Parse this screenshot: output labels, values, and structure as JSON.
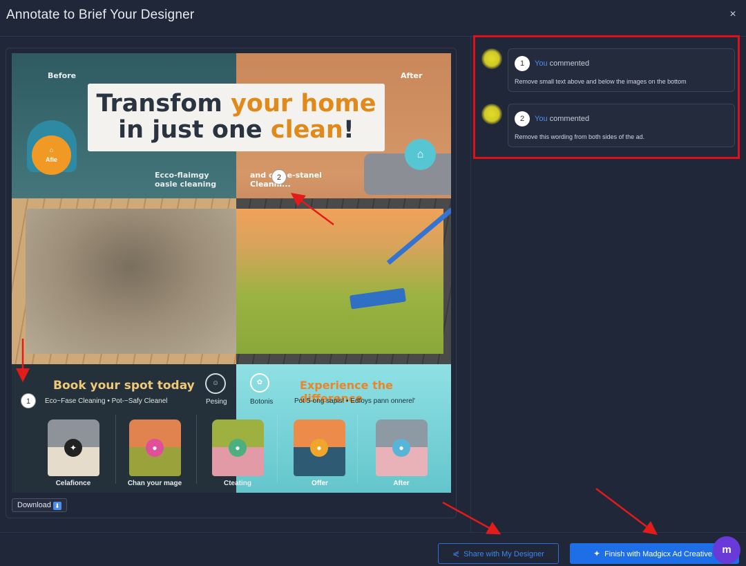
{
  "dialog": {
    "title": "Annotate to Brief Your Designer",
    "close_label": "×"
  },
  "ad": {
    "label_before": "Before",
    "label_after": "After",
    "headline_line1_dark": "Transfom",
    "headline_line1_orange": "your home",
    "headline_line2_dark": "in just one",
    "headline_line2_orange": "clean",
    "headline_line2_end": "!",
    "badge_left": "Afie",
    "badge_right": "⌂",
    "eco_left": "Ecco-flaimgy oasle cleaning",
    "eco_right": "and cl... e-stanel Cleanni...",
    "book_title": "Book your spot today",
    "exp_title": "Experience the difference",
    "sub_left": "Eco~Fase Cleaning   •   Pot-~Safy Cleanel",
    "sub_right": "Pot 5-ong sapis!   •   Edfoys pann onnerel'",
    "poll_left": "☺",
    "poll_right": "✿",
    "tag_left": "Pesing",
    "tag_right": "Botonis",
    "captions": [
      "Celafionce",
      "Chan your mage",
      "Cteating",
      "Offer",
      "After"
    ],
    "annotation_1": "1",
    "annotation_2": "2"
  },
  "download": {
    "label": "Download",
    "icon": "⬇"
  },
  "comments": [
    {
      "num": "1",
      "author": "You",
      "action": "commented",
      "text": "Remove small text above and below the images on the bottom"
    },
    {
      "num": "2",
      "author": "You",
      "action": "commented",
      "text": "Remove this wording from both sides of the ad."
    }
  ],
  "footer": {
    "share_label": "Share with My Designer",
    "finish_label": "Finish with Madgicx Ad Creative T",
    "fab_label": "m"
  },
  "colors": {
    "background": "#1f2738",
    "primary": "#1e6ee8",
    "highlight_box": "#e0101a",
    "author": "#4d8ef0"
  }
}
